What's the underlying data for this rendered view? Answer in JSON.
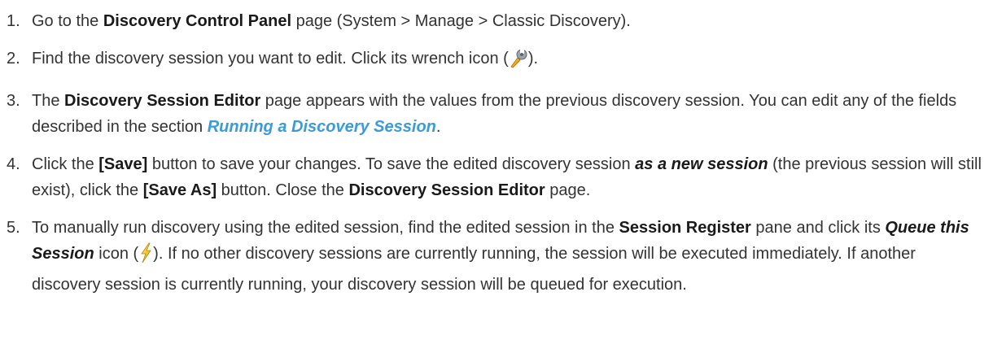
{
  "steps": [
    {
      "number": "1.",
      "parts": [
        "Go to the ",
        "Discovery Control Panel",
        " page (System > Manage > Classic Discovery)."
      ]
    },
    {
      "number": "2.",
      "parts": [
        "Find the discovery session you want to edit. Click its wrench icon (",
        ")."
      ],
      "icon": "wrench-icon"
    },
    {
      "number": "3.",
      "parts": [
        "The ",
        "Discovery Session Editor",
        " page appears with the values from the previous discovery session. You can edit any of the fields described in the section ",
        "Running a Discovery Session",
        "."
      ]
    },
    {
      "number": "4.",
      "parts": [
        "Click the ",
        "[Save]",
        " button to save your changes. To save the edited discovery session ",
        "as a new session",
        " (the previous session will still exist), click the ",
        "[Save As]",
        " button. Close the ",
        "Discovery Session Editor",
        " page."
      ]
    },
    {
      "number": "5.",
      "parts": [
        "To manually run discovery using the edited session, find the edited session in the ",
        "Session Register",
        " pane and click its ",
        "Queue this Session",
        " icon (",
        "). If no other discovery sessions are currently running, the session will be executed immediately. If another discovery session is currently running, your discovery session will be queued for execution."
      ],
      "icon": "lightning-icon"
    }
  ],
  "colors": {
    "text": "#333333",
    "link": "#3a9bdc"
  }
}
